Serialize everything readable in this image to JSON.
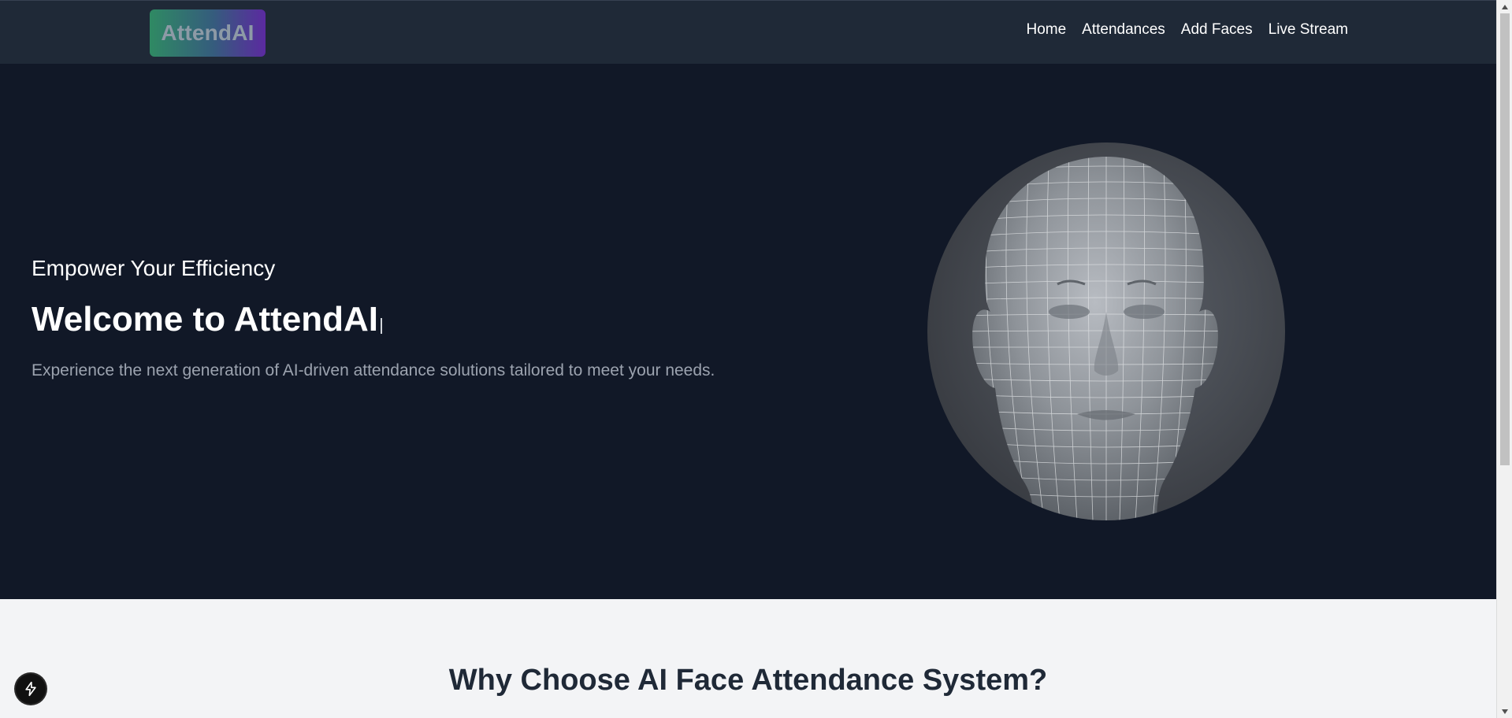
{
  "navbar": {
    "logo_text": "AttendAI",
    "links": [
      {
        "label": "Home"
      },
      {
        "label": "Attendances"
      },
      {
        "label": "Add Faces"
      },
      {
        "label": "Live Stream"
      }
    ]
  },
  "hero": {
    "tagline": "Empower Your Efficiency",
    "headline": "Welcome to AttendAI",
    "description": "Experience the next generation of AI-driven attendance solutions tailored to meet your needs.",
    "image_icon": "wireframe-face-icon"
  },
  "features": {
    "title": "Why Choose AI Face Attendance System?"
  },
  "floating_button": {
    "icon": "lightning-bolt-icon"
  },
  "colors": {
    "navbar_bg": "#1f2937",
    "hero_bg": "#111827",
    "section_bg": "#f3f4f6",
    "text_muted": "#9ca3af"
  }
}
